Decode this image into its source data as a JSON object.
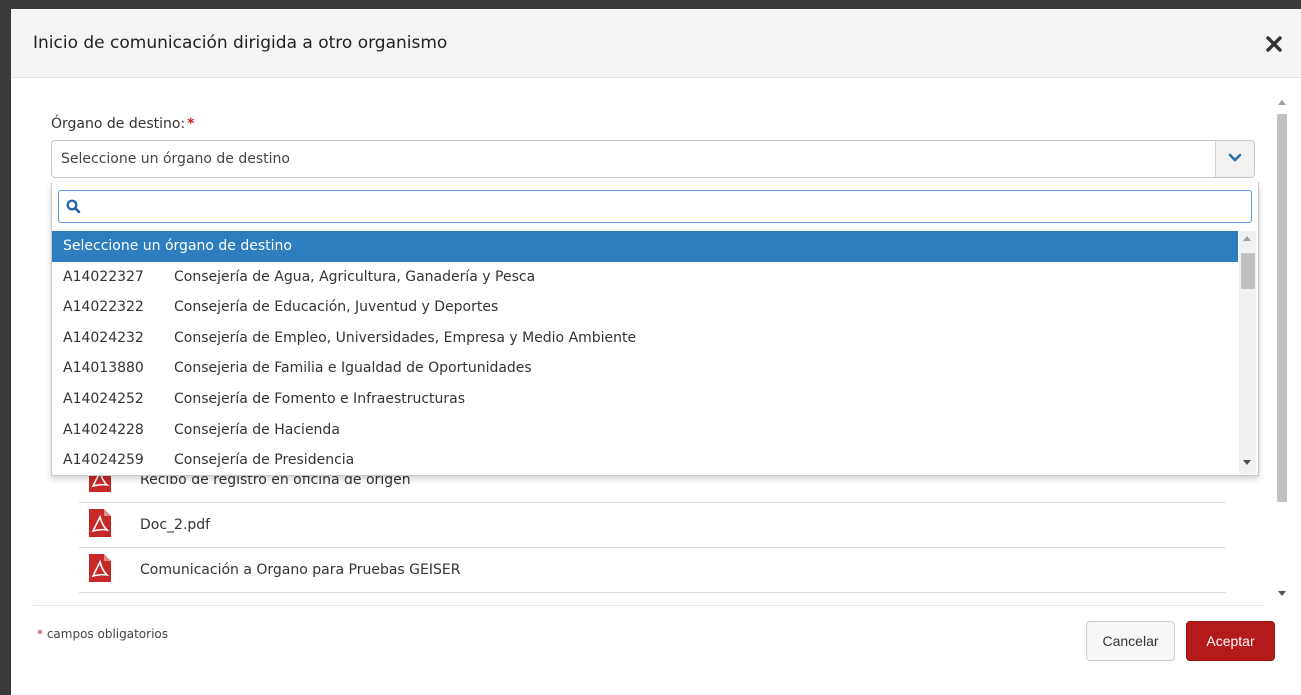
{
  "modal": {
    "title": "Inicio de comunicación dirigida a otro organismo",
    "close_icon": "close-icon"
  },
  "form": {
    "organo_label": "Órgano de destino:",
    "required_mark": "*",
    "select_value": "Seleccione un órgano de destino"
  },
  "dropdown": {
    "search_value": "",
    "search_placeholder": "",
    "items": [
      {
        "code": "",
        "name": "Seleccione un órgano de destino",
        "selected": true
      },
      {
        "code": "A14022327",
        "name": "Consejería de Agua, Agricultura, Ganadería y Pesca"
      },
      {
        "code": "A14022322",
        "name": "Consejería de Educación, Juventud y Deportes"
      },
      {
        "code": "A14024232",
        "name": "Consejería de Empleo, Universidades, Empresa y Medio Ambiente"
      },
      {
        "code": "A14013880",
        "name": "Consejeria de Familia e Igualdad de Oportunidades"
      },
      {
        "code": "A14024252",
        "name": "Consejería de Fomento e Infraestructuras"
      },
      {
        "code": "A14024228",
        "name": "Consejería de Hacienda"
      },
      {
        "code": "A14024259",
        "name": "Consejería de Presidencia"
      }
    ]
  },
  "documents": [
    {
      "icon": "pdf-icon",
      "label": "Recibo de registro en oficina de origen"
    },
    {
      "icon": "pdf-icon",
      "label": "Doc_2.pdf"
    },
    {
      "icon": "pdf-icon",
      "label": "Comunicación a Organo para Pruebas GEISER"
    }
  ],
  "footer": {
    "required_mark": "*",
    "note": "campos obligatorios",
    "cancel_label": "Cancelar",
    "accept_label": "Aceptar"
  },
  "colors": {
    "accent": "#2e7dbe",
    "primary_button": "#b51a1a",
    "required": "#c62828",
    "pdf_red": "#c62828"
  }
}
